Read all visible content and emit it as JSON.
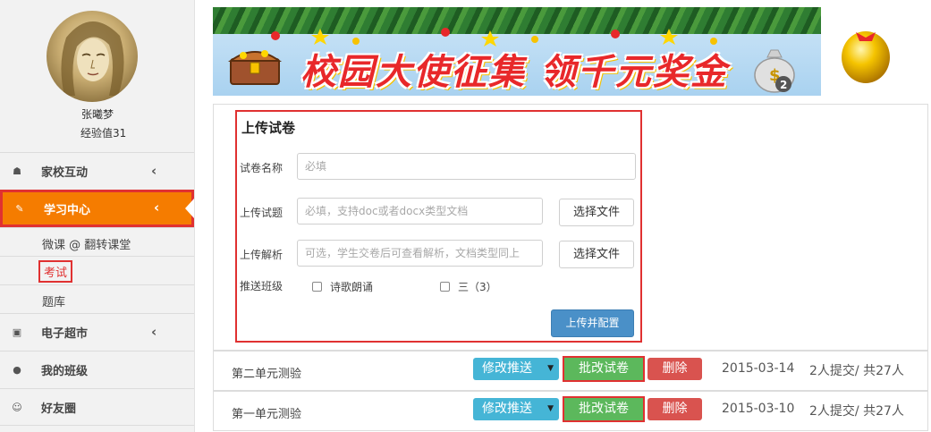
{
  "user": {
    "name": "张曦梦",
    "experience": "经验值31"
  },
  "nav": [
    {
      "icon": "home-icon",
      "label": "家校互动",
      "chevron": "‹"
    },
    {
      "icon": "edit-icon",
      "label": "学习中心",
      "chevron": "‹"
    },
    {
      "icon": "cart-icon",
      "label": "电子超市",
      "chevron": "‹"
    },
    {
      "icon": "user-icon",
      "label": "我的班级"
    },
    {
      "icon": "smile-icon",
      "label": "好友圈"
    }
  ],
  "subnav": [
    {
      "label": "微课 @ 翻转课堂"
    },
    {
      "label": "考试"
    },
    {
      "label": "题库"
    }
  ],
  "banner": {
    "text": "校园大使征集 领千元奖金",
    "badge": "2"
  },
  "upload_form": {
    "title": "上传试卷",
    "paper_name_label": "试卷名称",
    "paper_name_placeholder": "必填",
    "questions_label": "上传试题",
    "questions_placeholder": "必填，支持doc或者docx类型文档",
    "analysis_label": "上传解析",
    "analysis_placeholder": "可选，学生交卷后可查看解析，文档类型同上",
    "choose_file_label": "选择文件",
    "push_class_label": "推送班级",
    "classes": [
      "诗歌朗诵",
      "三（3）"
    ],
    "submit_label": "上传并配置"
  },
  "exams": [
    {
      "name": "第二单元测验",
      "push_label": "修改推送",
      "grade_label": "批改试卷",
      "delete_label": "删除",
      "date": "2015-03-14",
      "submitted": "2人提交/",
      "total": "共27人"
    },
    {
      "name": "第一单元测验",
      "push_label": "修改推送",
      "grade_label": "批改试卷",
      "delete_label": "删除",
      "date": "2015-03-10",
      "submitted": "2人提交/",
      "total": "共27人"
    }
  ],
  "colors": {
    "active_nav": "#f57c00",
    "highlight_border": "#e03131",
    "push": "#45b5d6",
    "grade": "#5cb85c",
    "delete": "#d9534f",
    "submit": "#4a90c8"
  }
}
